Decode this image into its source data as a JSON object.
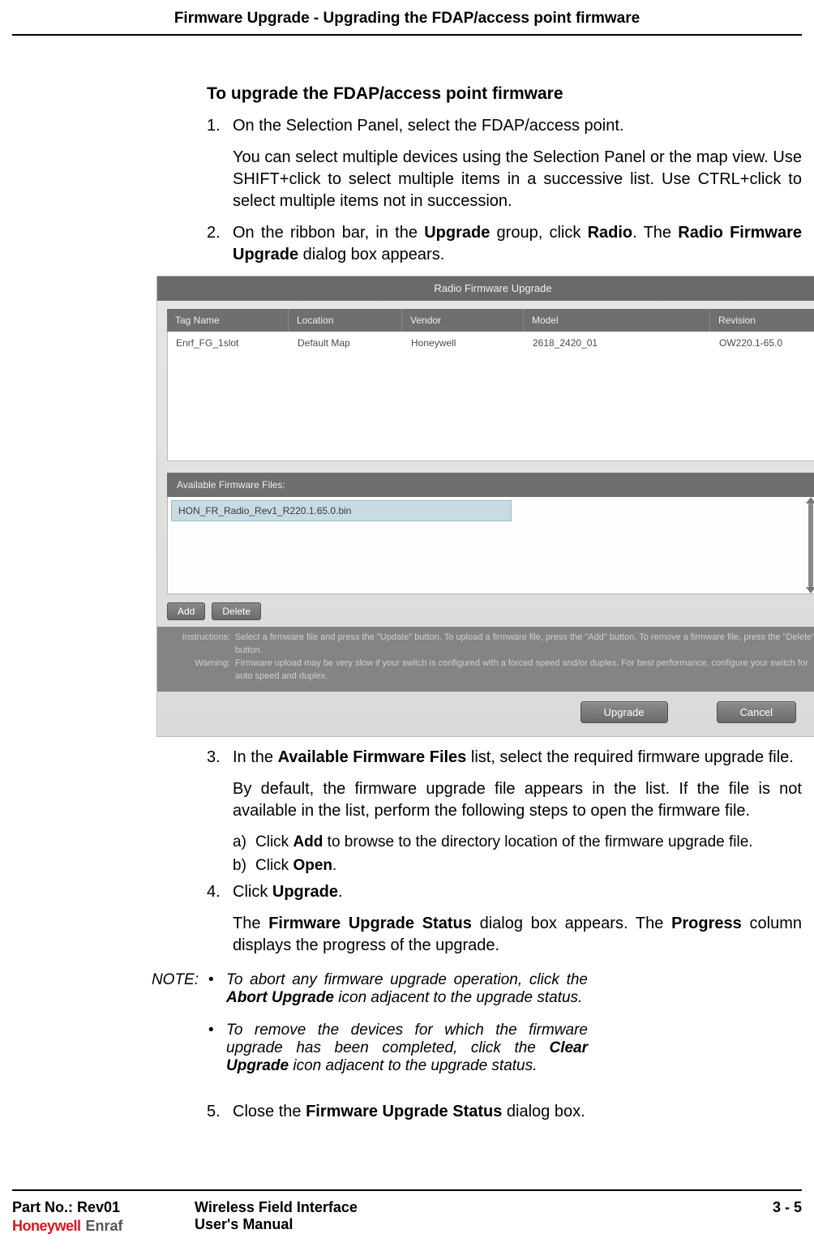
{
  "header": "Firmware Upgrade - Upgrading the FDAP/access point firmware",
  "section_heading": "To upgrade the FDAP/access point firmware",
  "steps": {
    "s1": {
      "num": "1.",
      "p1": "On the Selection Panel, select the FDAP/access point.",
      "p2": "You can select multiple devices using the Selection Panel or the map view. Use SHIFT+click to select multiple items in a successive list. Use CTRL+click to select multiple items not in succession."
    },
    "s2": {
      "num": "2.",
      "pre": "On the ribbon bar, in the ",
      "b1": "Upgrade",
      "mid": " group, click ",
      "b2": "Radio",
      "post": ". The ",
      "b3": "Radio Firmware Upgrade",
      "end": " dialog box appears."
    },
    "s3": {
      "num": "3.",
      "pre": "In the ",
      "b1": "Available Firmware Files",
      "post": " list, select the required firmware upgrade file.",
      "p2": "By default, the firmware upgrade file appears in the list. If the file is not available in the list, perform the following steps to open the firmware file.",
      "a": {
        "lbl": "a)",
        "pre": "Click ",
        "b": "Add",
        "post": " to browse to the directory location of the firmware upgrade file."
      },
      "b": {
        "lbl": "b)",
        "pre": "Click ",
        "bold": "Open",
        "post": "."
      }
    },
    "s4": {
      "num": "4.",
      "pre": "Click ",
      "b1": "Upgrade",
      "post": ".",
      "p2pre": "The ",
      "p2b1": "Firmware Upgrade Status",
      "p2mid": " dialog box appears. The ",
      "p2b2": "Progress",
      "p2post": " column displays the progress of the upgrade."
    },
    "s5": {
      "num": "5.",
      "pre": "Close the ",
      "b1": "Firmware Upgrade Status",
      "post": " dialog box."
    }
  },
  "note": {
    "label": "NOTE:",
    "i1": {
      "pre": "To abort any firmware upgrade operation, click the ",
      "b": "Abort Upgrade",
      "post": " icon adjacent to the upgrade status."
    },
    "i2": {
      "pre": " To remove the devices for which the firmware upgrade has been completed, click the ",
      "b": "Clear Upgrade",
      "post": " icon adjacent to the upgrade status."
    }
  },
  "dialog": {
    "title": "Radio Firmware Upgrade",
    "close": "×",
    "cols": {
      "tag": "Tag Name",
      "loc": "Location",
      "ven": "Vendor",
      "mod": "Model",
      "rev": "Revision"
    },
    "row": {
      "tag": "Enrf_FG_1slot",
      "loc": "Default Map",
      "ven": "Honeywell",
      "mod": "2618_2420_01",
      "rev": "OW220.1-65.0"
    },
    "avail_label": "Available Firmware Files:",
    "avail_item": "HON_FR_Radio_Rev1_R220.1.65.0.bin",
    "btn_add": "Add",
    "btn_delete": "Delete",
    "instr_l1": "Instructions:",
    "instr_t1": "Select a firmware file and press the \"Update\" button. To upload a firmware file, press the \"Add\" button. To remove a firmware file, press the \"Delete\" button.",
    "instr_l2": "Warning:",
    "instr_t2": "Firmware upload may be very slow if your switch is configured with a forced speed and/or duplex. For best performance, configure your switch for auto speed and duplex.",
    "btn_upgrade": "Upgrade",
    "btn_cancel": "Cancel"
  },
  "footer": {
    "part": "Part No.: Rev01",
    "brand_hw": "Honeywell",
    "brand_en": "Enraf",
    "mid1": "Wireless Field Interface",
    "mid2": "User's Manual",
    "page": "3 - 5"
  }
}
